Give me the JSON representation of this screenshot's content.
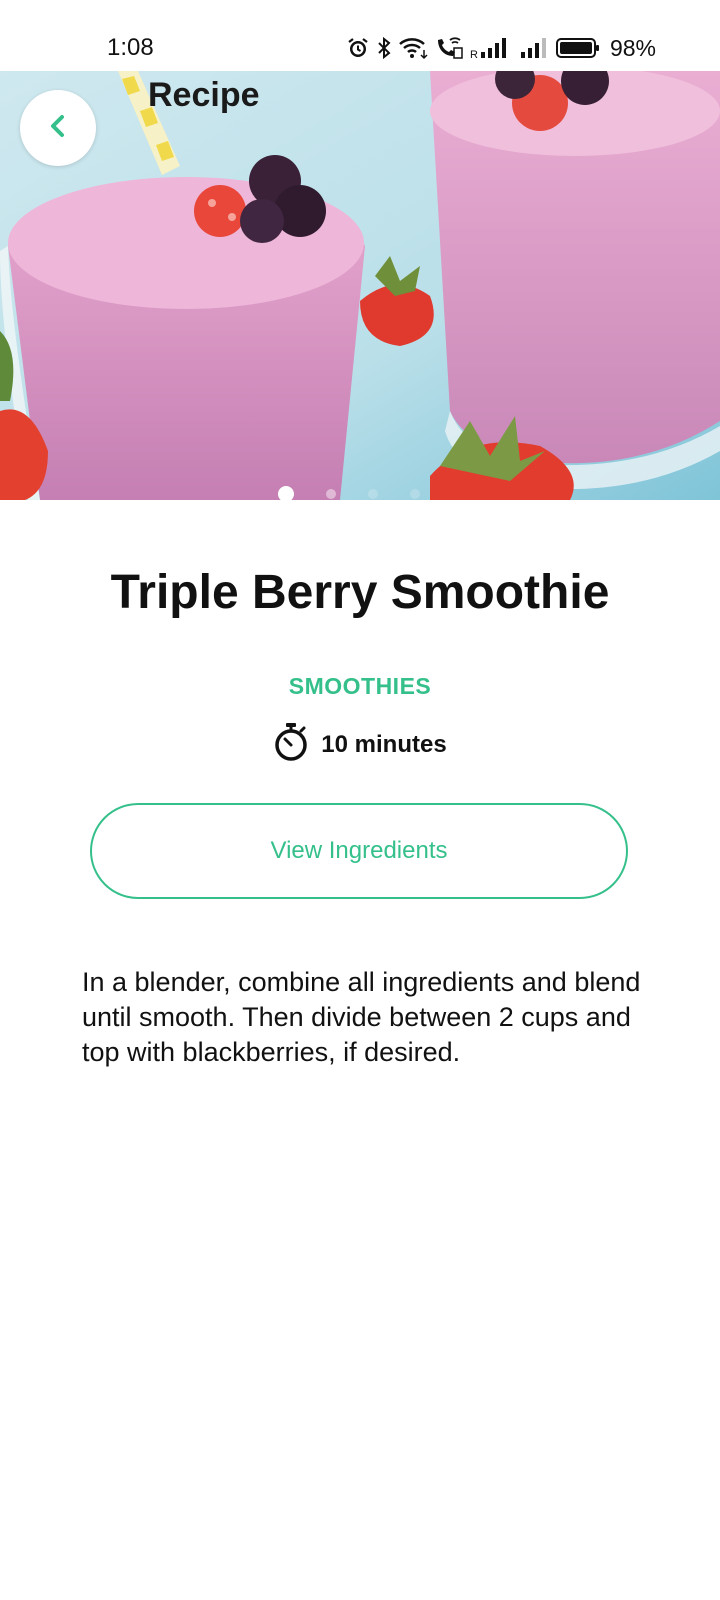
{
  "status_bar": {
    "time": "1:08",
    "battery_percent": "98%",
    "icons": [
      "alarm-icon",
      "bluetooth-icon",
      "wifi-icon",
      "wifi-calling-icon",
      "signal-icon",
      "signal-icon",
      "battery-icon"
    ],
    "roaming_label": "R"
  },
  "app_bar": {
    "title": "Recipe",
    "back_icon": "chevron-left-icon",
    "accent_color": "#35c08b"
  },
  "carousel": {
    "page_count": 4,
    "active_index": 0
  },
  "recipe": {
    "title": "Triple Berry Smoothie",
    "category": "SMOOTHIES",
    "time_icon": "stopwatch-icon",
    "time": "10 minutes",
    "ingredients_button": "View Ingredients",
    "instructions": "In a blender, combine all ingredients and blend until smooth. Then divide between 2 cups and top with blackberries, if desired."
  }
}
